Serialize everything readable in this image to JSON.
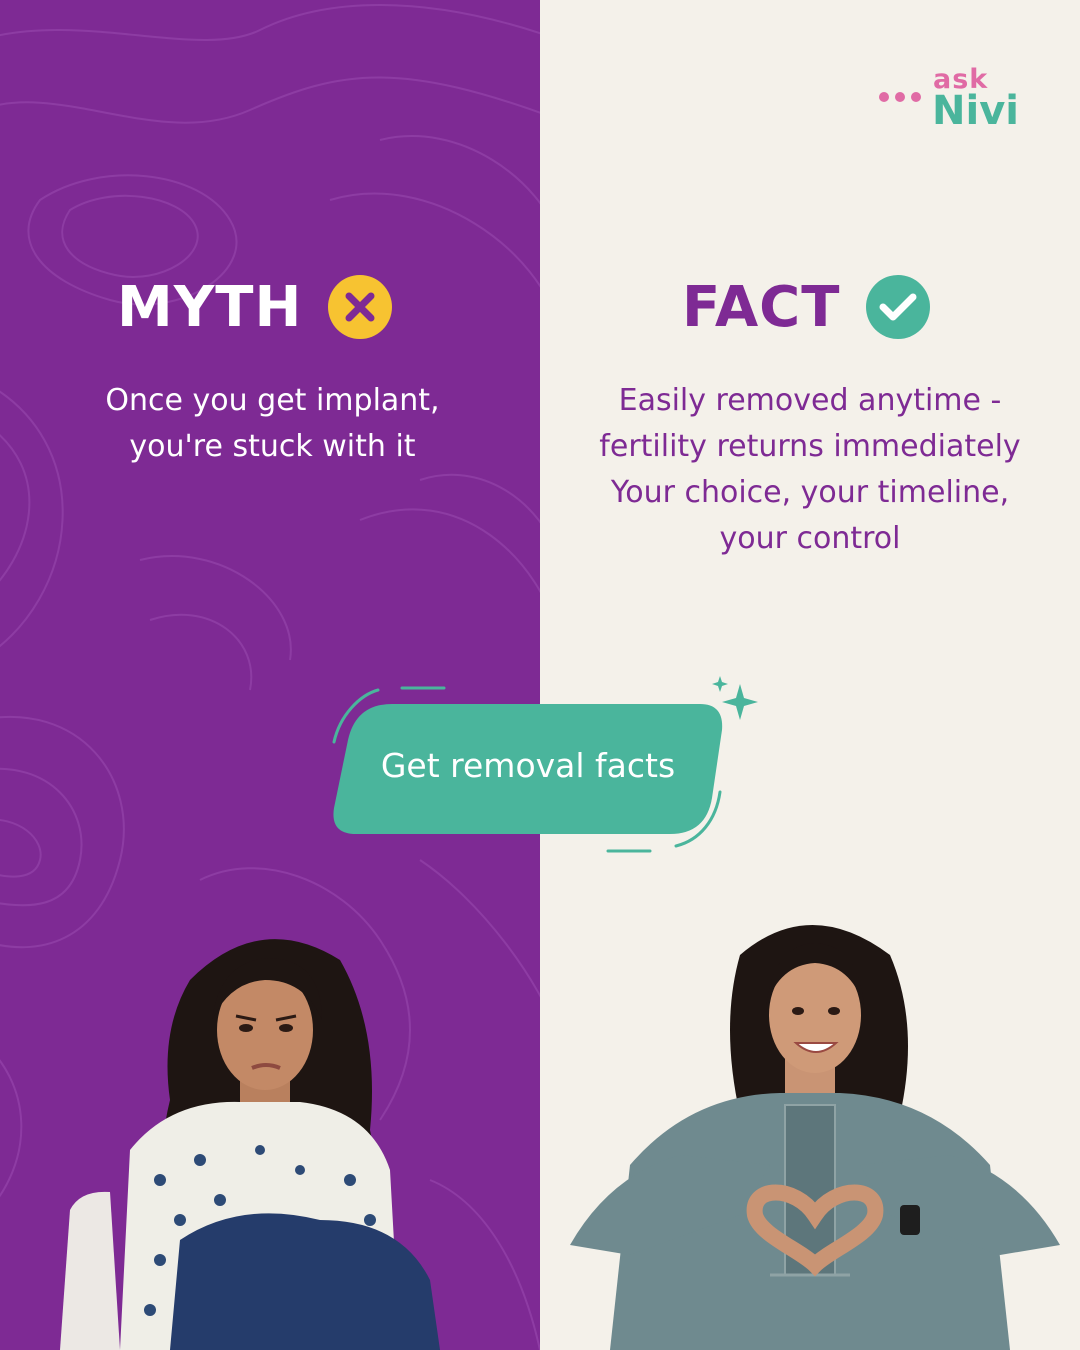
{
  "brand": {
    "ask": "ask",
    "name": "Nivi",
    "dots_color": "#e06ba5",
    "name_color": "#4ab59c"
  },
  "colors": {
    "purple": "#7e2a94",
    "cream": "#f4f1ea",
    "teal": "#4ab59c",
    "yellow": "#f7c331",
    "pink": "#e06ba5"
  },
  "myth": {
    "title": "MYTH",
    "icon": "x-circle-icon",
    "lines": [
      "Once you get implant,",
      "you're stuck with it"
    ]
  },
  "fact": {
    "title": "FACT",
    "icon": "check-circle-icon",
    "lines": [
      "Easily removed anytime -",
      "fertility returns immediately",
      "Your choice, your timeline,",
      "your control"
    ]
  },
  "cta": {
    "label": "Get removal facts"
  },
  "images": {
    "left_person": "worried-woman-photo",
    "right_person": "smiling-woman-heart-hands-photo"
  }
}
